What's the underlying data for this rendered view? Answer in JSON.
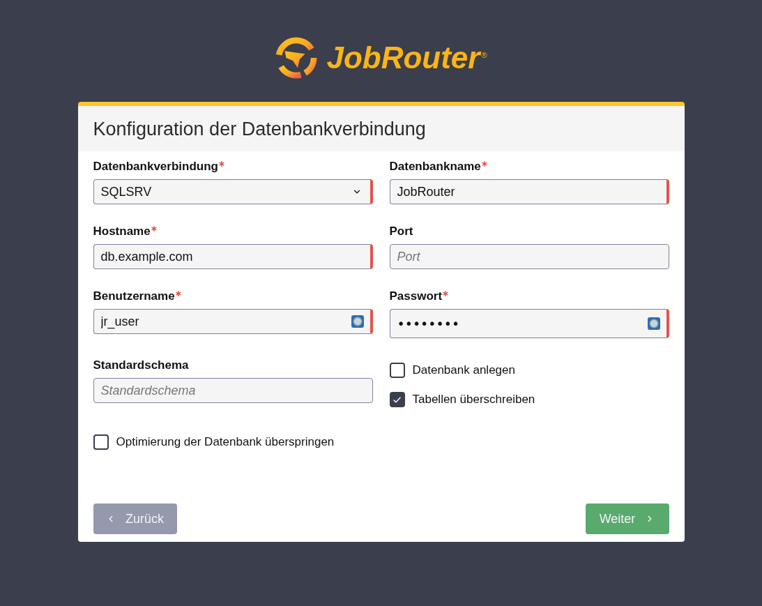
{
  "logo": {
    "text": "JobRouter",
    "mark": "®"
  },
  "card": {
    "title": "Konfiguration der Datenbankverbindung"
  },
  "rows": [
    {
      "cells": [
        {
          "kind": "select",
          "label": "Datenbankverbindung",
          "required": true,
          "value": "SQLSRV"
        },
        {
          "kind": "text",
          "label": "Datenbankname",
          "required": true,
          "value": "JobRouter",
          "autofill_icon": false
        }
      ]
    },
    {
      "cells": [
        {
          "kind": "text",
          "label": "Hostname",
          "required": true,
          "value": "db.example.com",
          "autofill_icon": false
        },
        {
          "kind": "text",
          "label": "Port",
          "required": false,
          "placeholder": "Port",
          "autofill_icon": false
        }
      ]
    },
    {
      "cells": [
        {
          "kind": "text",
          "label": "Benutzername",
          "required": true,
          "value": "jr_user",
          "autofill_icon": true
        },
        {
          "kind": "password",
          "label": "Passwort",
          "required": true,
          "value": "••••••••",
          "autofill_icon": true
        }
      ]
    },
    {
      "cells": [
        {
          "kind": "text",
          "label": "Standardschema",
          "required": false,
          "placeholder": "Standardschema",
          "autofill_icon": false
        },
        {
          "kind": "checkbox_group",
          "items": [
            {
              "label": "Datenbank anlegen",
              "checked": false
            },
            {
              "label": "Tabellen überschreiben",
              "checked": true
            }
          ]
        }
      ]
    },
    {
      "cells": [
        {
          "kind": "checkbox",
          "label": "Optimierung der Datenbank überspringen",
          "checked": false
        }
      ]
    }
  ],
  "buttons": [
    {
      "kind": "back",
      "label": "Zurück"
    },
    {
      "kind": "next",
      "label": "Weiter"
    }
  ]
}
